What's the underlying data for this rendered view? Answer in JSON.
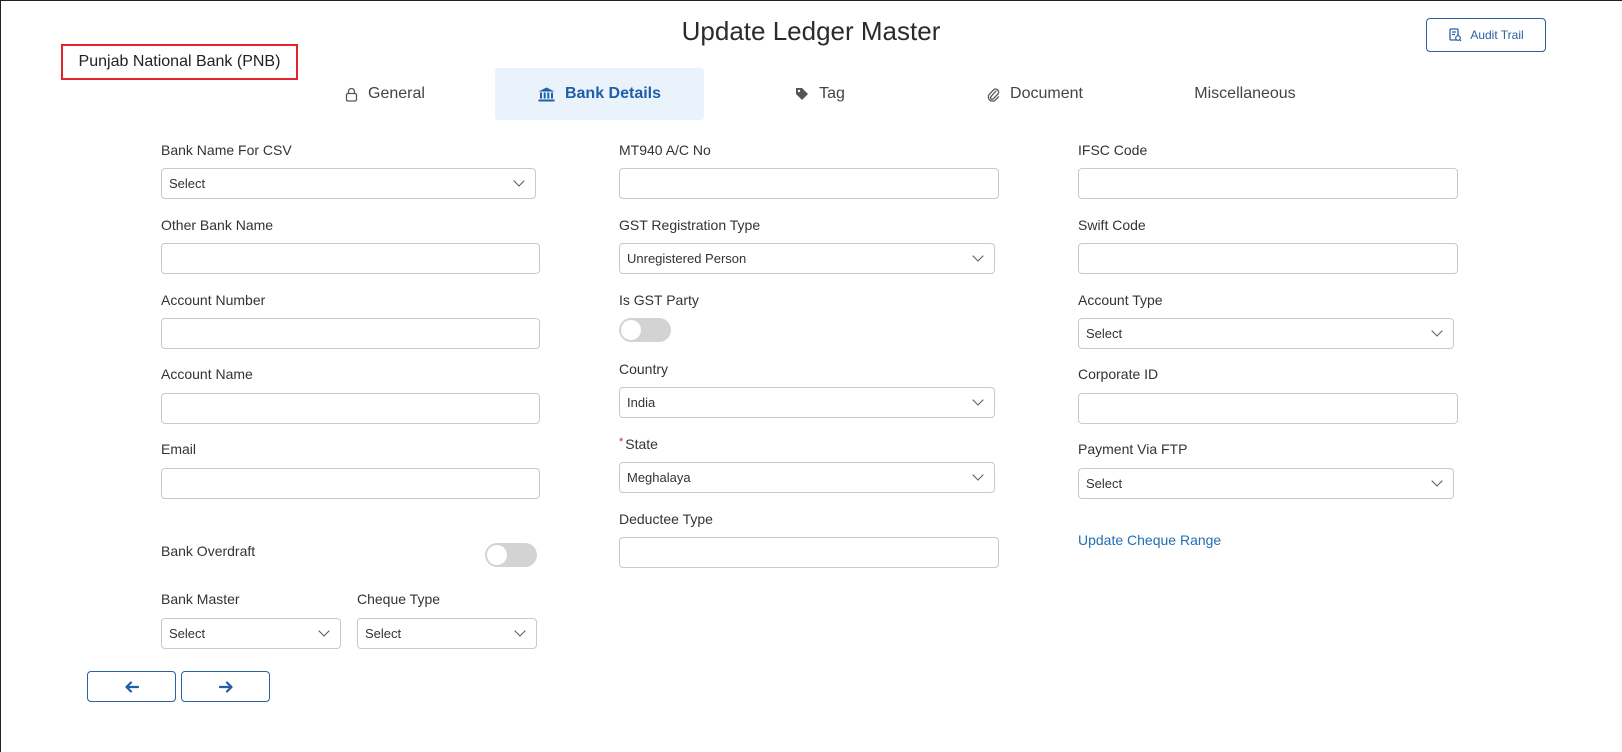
{
  "header": {
    "title": "Update Ledger Master",
    "ledger_name": "Punjab National Bank (PNB)",
    "audit_trail_label": "Audit Trail"
  },
  "tabs": [
    {
      "label": "General",
      "icon": "lock-icon",
      "active": false
    },
    {
      "label": "Bank Details",
      "icon": "bank-icon",
      "active": true
    },
    {
      "label": "Tag",
      "icon": "tag-icon",
      "active": false
    },
    {
      "label": "Document",
      "icon": "paperclip-icon",
      "active": false
    },
    {
      "label": "Miscellaneous",
      "icon": "",
      "active": false
    }
  ],
  "left": {
    "bank_name_csv": {
      "label": "Bank Name For CSV",
      "value": "Select"
    },
    "other_bank_name": {
      "label": "Other Bank Name",
      "value": ""
    },
    "account_number": {
      "label": "Account Number",
      "value": ""
    },
    "account_name": {
      "label": "Account Name",
      "value": ""
    },
    "email": {
      "label": "Email",
      "value": ""
    },
    "bank_overdraft": {
      "label": "Bank Overdraft",
      "on": false
    },
    "bank_master": {
      "label": "Bank Master",
      "value": "Select"
    },
    "cheque_type": {
      "label": "Cheque Type",
      "value": "Select"
    }
  },
  "middle": {
    "mt940": {
      "label": "MT940 A/C No",
      "value": ""
    },
    "gst_reg_type": {
      "label": "GST Registration Type",
      "value": "Unregistered Person"
    },
    "is_gst_party": {
      "label": "Is GST Party",
      "on": false
    },
    "country": {
      "label": "Country",
      "value": "India"
    },
    "state": {
      "label": "State",
      "required_mark": "*",
      "value": "Meghalaya"
    },
    "deductee_type": {
      "label": "Deductee Type",
      "value": ""
    }
  },
  "right": {
    "ifsc": {
      "label": "IFSC Code",
      "value": ""
    },
    "swift": {
      "label": "Swift Code",
      "value": ""
    },
    "account_type": {
      "label": "Account Type",
      "value": "Select"
    },
    "corporate_id": {
      "label": "Corporate ID",
      "value": ""
    },
    "payment_ftp": {
      "label": "Payment Via FTP",
      "value": "Select"
    },
    "update_cheque_range": "Update Cheque Range"
  },
  "nav": {
    "prev_icon": "arrow-left-icon",
    "next_icon": "arrow-right-icon"
  },
  "colors": {
    "accent": "#1f5fa8",
    "active_tab_bg": "#eaf3fb",
    "highlight_border": "#e0242b"
  }
}
